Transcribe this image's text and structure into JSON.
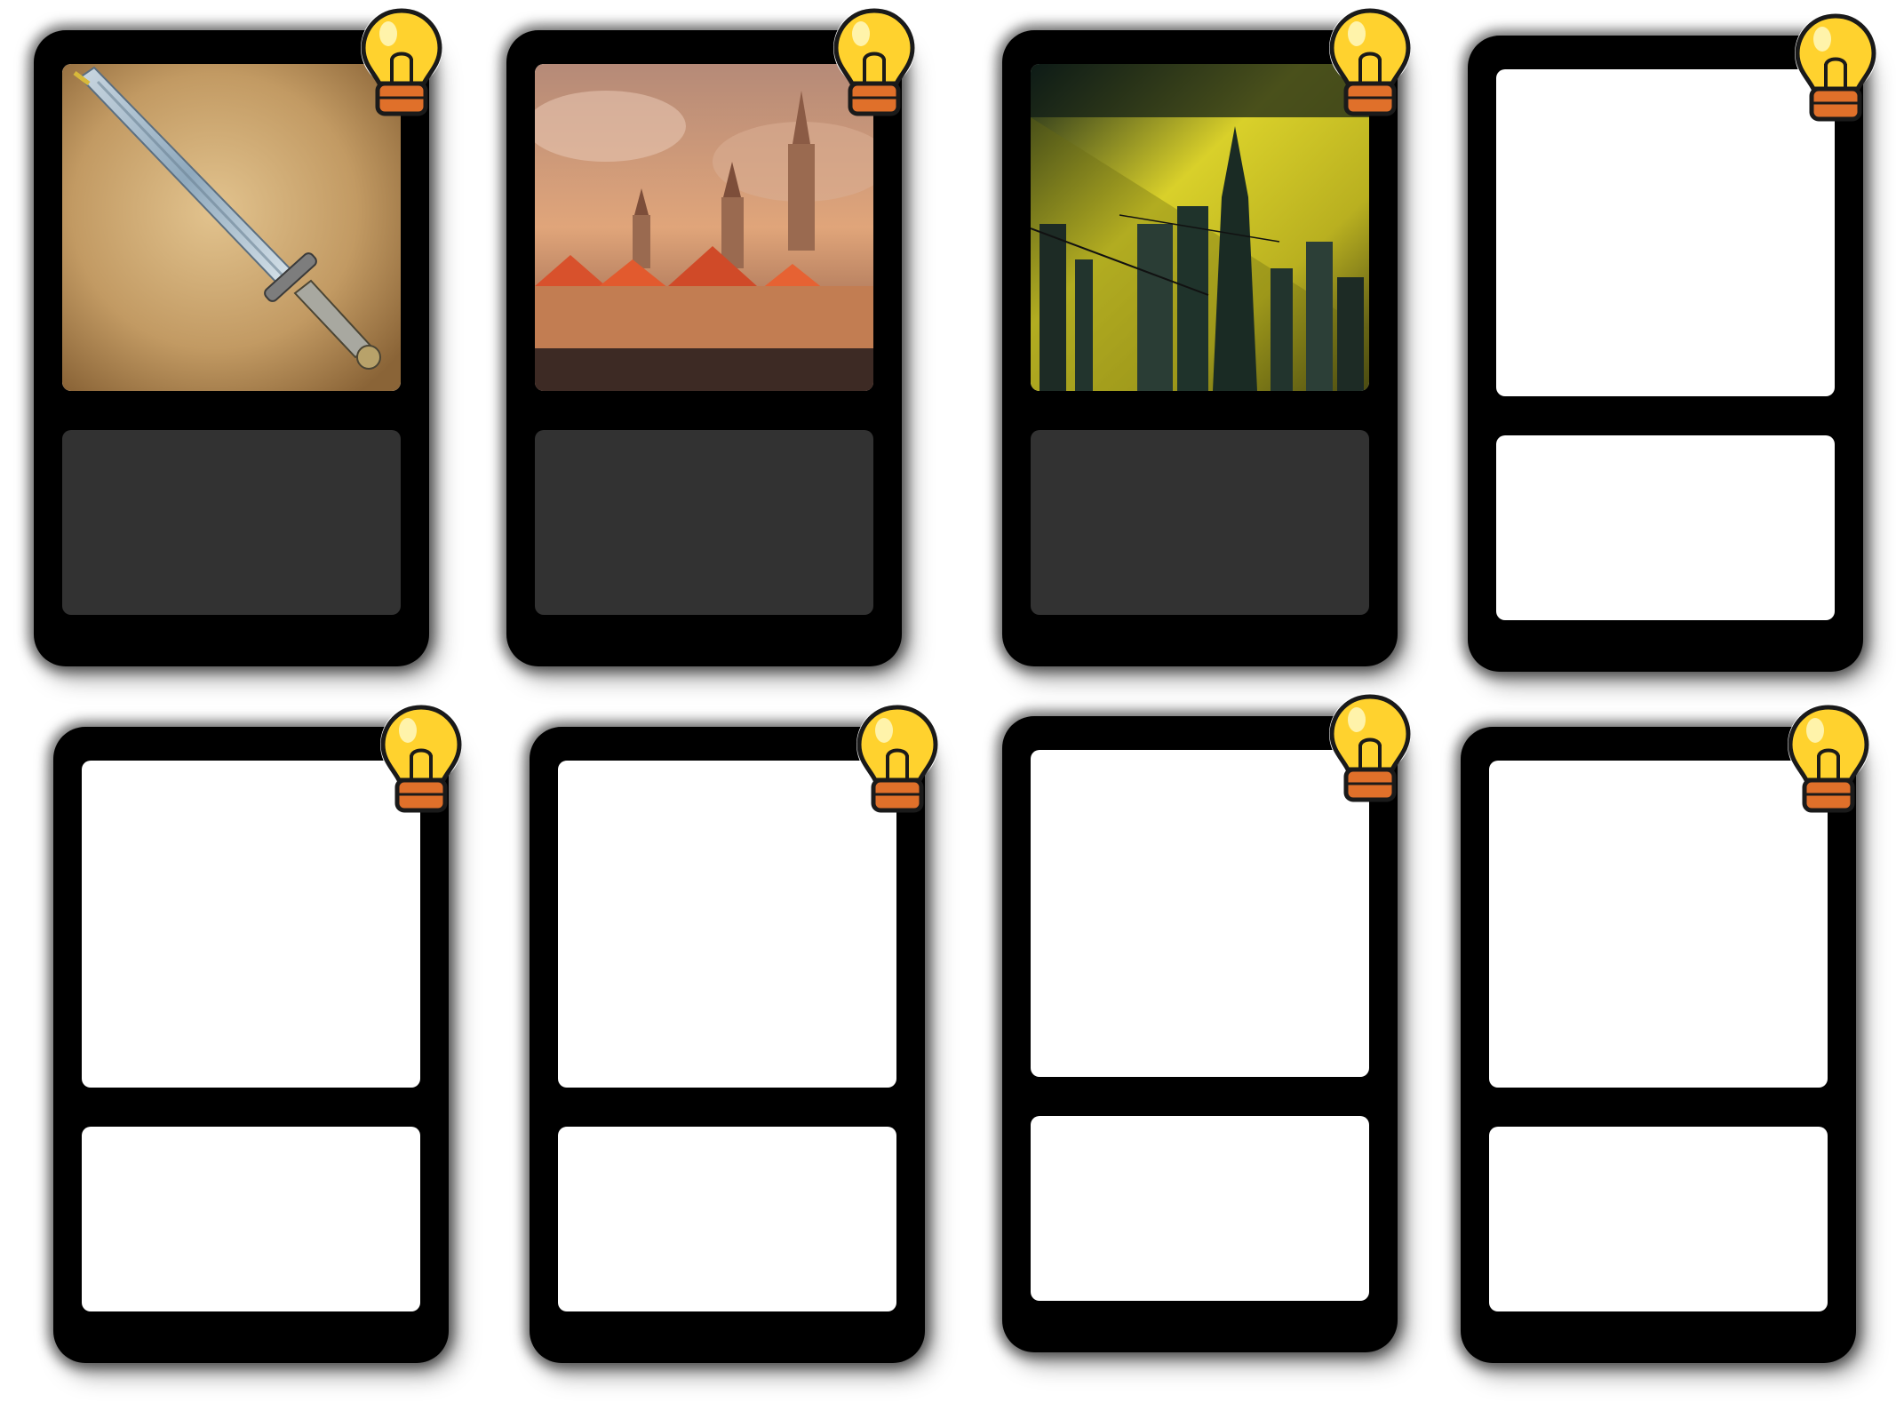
{
  "cards": [
    {
      "art": "sword",
      "text_box": "dark"
    },
    {
      "art": "castle-town",
      "text_box": "dark"
    },
    {
      "art": "cyber-city",
      "text_box": "dark"
    },
    {
      "art": "blank",
      "text_box": "white"
    },
    {
      "art": "blank",
      "text_box": "white"
    },
    {
      "art": "blank",
      "text_box": "white"
    },
    {
      "art": "blank",
      "text_box": "white"
    },
    {
      "art": "blank",
      "text_box": "white"
    }
  ],
  "icons": {
    "idea": "lightbulb-icon"
  },
  "colors": {
    "frame": "#000000",
    "dark_text_box": "#323232",
    "bulb_glass": "#ffd22e",
    "bulb_base": "#e0702a"
  }
}
